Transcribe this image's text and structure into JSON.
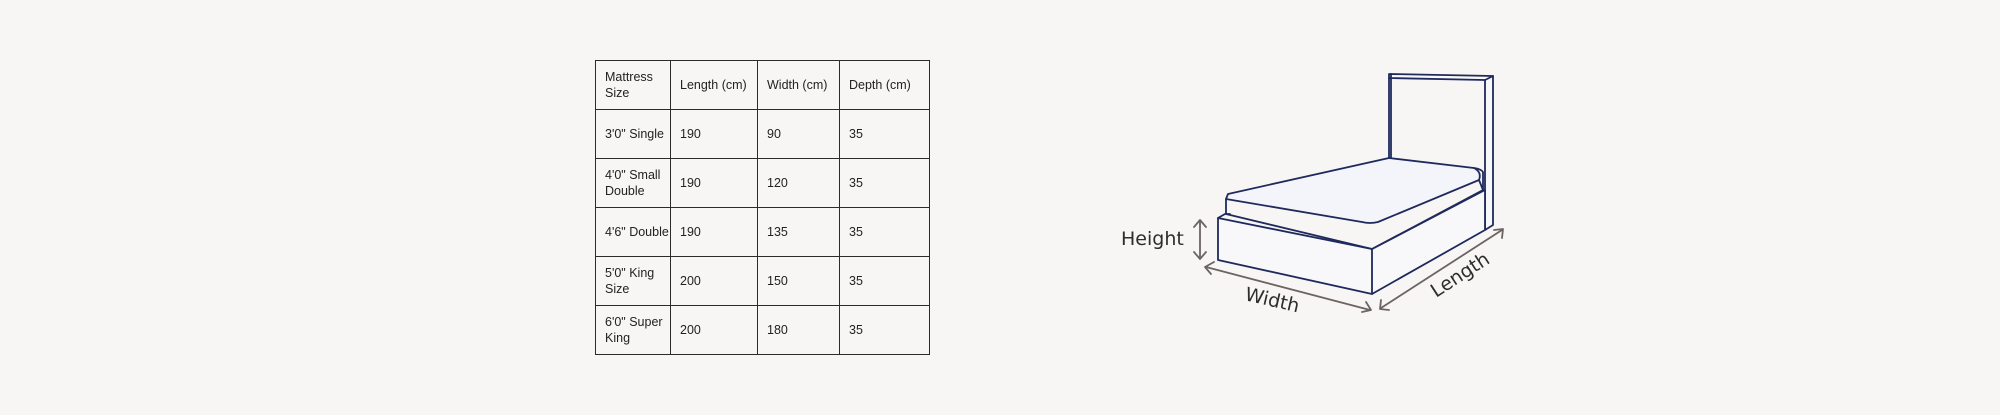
{
  "size_table": {
    "headers": [
      "Mattress Size",
      "Length (cm)",
      "Width (cm)",
      "Depth (cm)"
    ],
    "rows": [
      {
        "size": "3'0\" Single",
        "length": "190",
        "width": "90",
        "depth": "35"
      },
      {
        "size": "4'0\" Small Double",
        "length": "190",
        "width": "120",
        "depth": "35"
      },
      {
        "size": "4'6\" Double",
        "length": "190",
        "width": "135",
        "depth": "35"
      },
      {
        "size": "5'0\" King Size",
        "length": "200",
        "width": "150",
        "depth": "35"
      },
      {
        "size": "6'0\" Super King",
        "length": "200",
        "width": "180",
        "depth": "35"
      }
    ]
  },
  "diagram": {
    "height_label": "Height",
    "width_label": "Width",
    "length_label": "Length",
    "colors": {
      "outline": "#1f2a5c",
      "arrow": "#6b6462",
      "mattress_fill": "#f4f5fa",
      "base_fill": "#f8f8fa"
    }
  }
}
